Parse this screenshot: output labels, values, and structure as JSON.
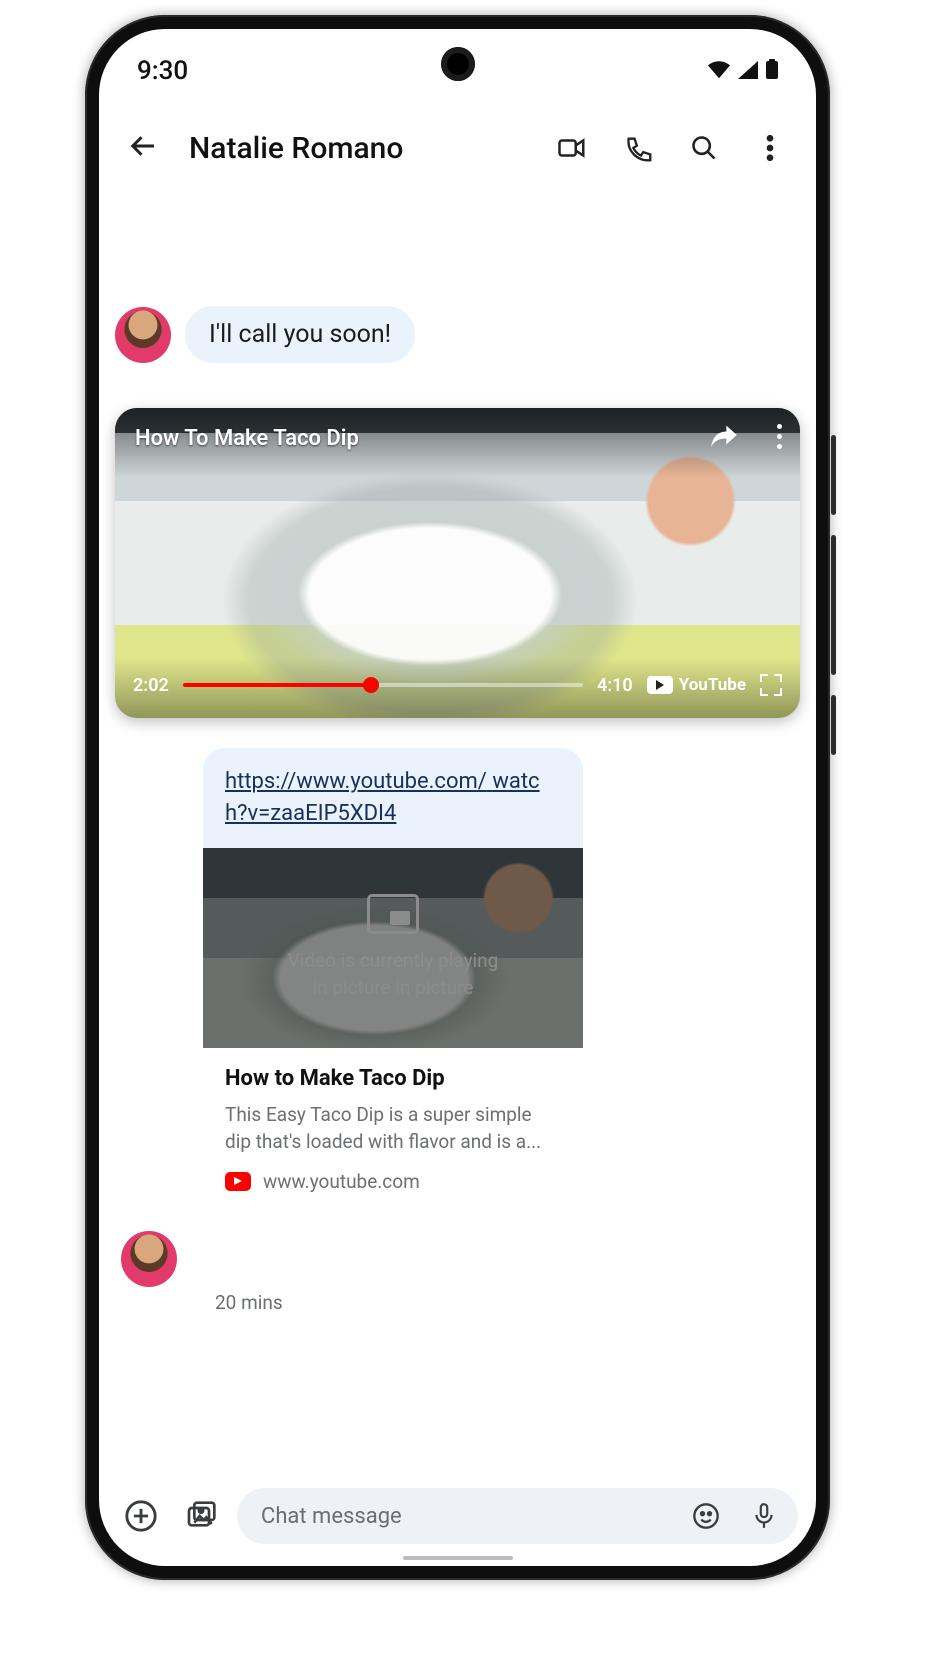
{
  "status": {
    "time": "9:30"
  },
  "header": {
    "title": "Natalie Romano"
  },
  "messages": {
    "incoming1": "I'll call you soon!"
  },
  "pip": {
    "title": "How To Make Taco Dip",
    "elapsed": "2:02",
    "duration": "4:10",
    "provider": "YouTube"
  },
  "link": {
    "url_line1": "https://www.youtube.com/",
    "url_line2": "watch?v=zaaEIP5XDI4",
    "overlay_line1": "Video is currently playing",
    "overlay_line2": "in picture in picture",
    "preview_title": "How to Make Taco Dip",
    "preview_desc": "This Easy Taco Dip is a super simple dip that's loaded with flavor and is a...",
    "source": "www.youtube.com",
    "timestamp": "20 mins"
  },
  "composer": {
    "placeholder": "Chat message"
  }
}
